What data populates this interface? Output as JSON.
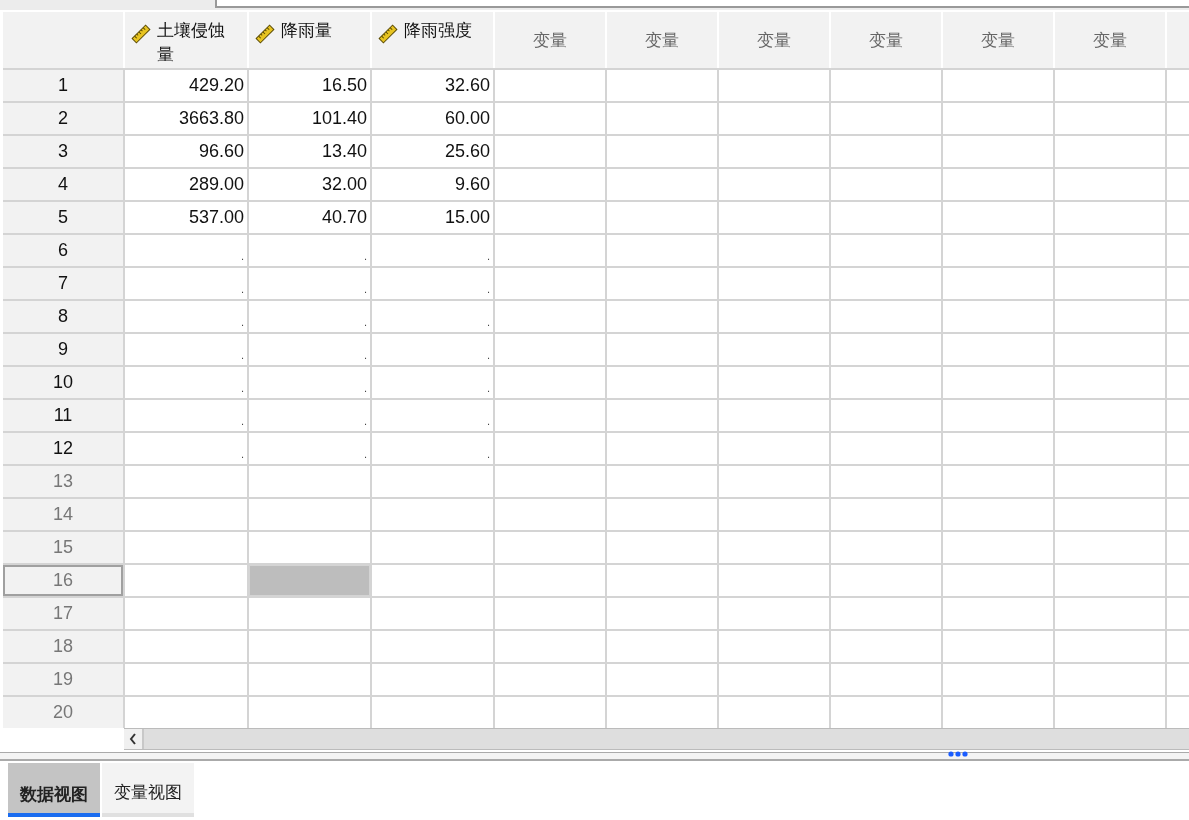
{
  "columns": [
    {
      "name": "土壤侵蚀量",
      "kind": "scale"
    },
    {
      "name": "降雨量",
      "kind": "scale"
    },
    {
      "name": "降雨强度",
      "kind": "scale"
    },
    {
      "name": "变量",
      "kind": "empty"
    },
    {
      "name": "变量",
      "kind": "empty"
    },
    {
      "name": "变量",
      "kind": "empty"
    },
    {
      "name": "变量",
      "kind": "empty"
    },
    {
      "name": "变量",
      "kind": "empty"
    },
    {
      "name": "变量",
      "kind": "empty"
    }
  ],
  "rows": [
    {
      "label": "1",
      "has_data": true,
      "selected": false,
      "cells": [
        {
          "value": "429.20",
          "selected": false
        },
        {
          "value": "16.50",
          "selected": false
        },
        {
          "value": "32.60",
          "selected": false
        }
      ]
    },
    {
      "label": "2",
      "has_data": true,
      "selected": false,
      "cells": [
        {
          "value": "3663.80",
          "selected": false
        },
        {
          "value": "101.40",
          "selected": false
        },
        {
          "value": "60.00",
          "selected": false
        }
      ]
    },
    {
      "label": "3",
      "has_data": true,
      "selected": false,
      "cells": [
        {
          "value": "96.60",
          "selected": false
        },
        {
          "value": "13.40",
          "selected": false
        },
        {
          "value": "25.60",
          "selected": false
        }
      ]
    },
    {
      "label": "4",
      "has_data": true,
      "selected": false,
      "cells": [
        {
          "value": "289.00",
          "selected": false
        },
        {
          "value": "32.00",
          "selected": false
        },
        {
          "value": "9.60",
          "selected": false
        }
      ]
    },
    {
      "label": "5",
      "has_data": true,
      "selected": false,
      "cells": [
        {
          "value": "537.00",
          "selected": false
        },
        {
          "value": "40.70",
          "selected": false
        },
        {
          "value": "15.00",
          "selected": false
        }
      ]
    },
    {
      "label": "6",
      "has_data": true,
      "selected": false,
      "cells": [
        {
          "value": ".",
          "selected": false
        },
        {
          "value": ".",
          "selected": false
        },
        {
          "value": ".",
          "selected": false
        }
      ]
    },
    {
      "label": "7",
      "has_data": true,
      "selected": false,
      "cells": [
        {
          "value": ".",
          "selected": false
        },
        {
          "value": ".",
          "selected": false
        },
        {
          "value": ".",
          "selected": false
        }
      ]
    },
    {
      "label": "8",
      "has_data": true,
      "selected": false,
      "cells": [
        {
          "value": ".",
          "selected": false
        },
        {
          "value": ".",
          "selected": false
        },
        {
          "value": ".",
          "selected": false
        }
      ]
    },
    {
      "label": "9",
      "has_data": true,
      "selected": false,
      "cells": [
        {
          "value": ".",
          "selected": false
        },
        {
          "value": ".",
          "selected": false
        },
        {
          "value": ".",
          "selected": false
        }
      ]
    },
    {
      "label": "10",
      "has_data": true,
      "selected": false,
      "cells": [
        {
          "value": ".",
          "selected": false
        },
        {
          "value": ".",
          "selected": false
        },
        {
          "value": ".",
          "selected": false
        }
      ]
    },
    {
      "label": "11",
      "has_data": true,
      "selected": false,
      "cells": [
        {
          "value": ".",
          "selected": false
        },
        {
          "value": ".",
          "selected": false
        },
        {
          "value": ".",
          "selected": false
        }
      ]
    },
    {
      "label": "12",
      "has_data": true,
      "selected": false,
      "cells": [
        {
          "value": ".",
          "selected": false
        },
        {
          "value": ".",
          "selected": false
        },
        {
          "value": ".",
          "selected": false
        }
      ]
    },
    {
      "label": "13",
      "has_data": false,
      "selected": false,
      "cells": [
        {
          "selected": false
        },
        {
          "selected": false
        },
        {
          "selected": false
        }
      ]
    },
    {
      "label": "14",
      "has_data": false,
      "selected": false,
      "cells": [
        {
          "selected": false
        },
        {
          "selected": false
        },
        {
          "selected": false
        }
      ]
    },
    {
      "label": "15",
      "has_data": false,
      "selected": false,
      "cells": [
        {
          "selected": false
        },
        {
          "selected": false
        },
        {
          "selected": false
        }
      ]
    },
    {
      "label": "16",
      "has_data": false,
      "selected": true,
      "cells": [
        {
          "selected": false
        },
        {
          "selected": true
        },
        {
          "selected": false
        }
      ]
    },
    {
      "label": "17",
      "has_data": false,
      "selected": false,
      "cells": [
        {
          "selected": false
        },
        {
          "selected": false
        },
        {
          "selected": false
        }
      ]
    },
    {
      "label": "18",
      "has_data": false,
      "selected": false,
      "cells": [
        {
          "selected": false
        },
        {
          "selected": false
        },
        {
          "selected": false
        }
      ]
    },
    {
      "label": "19",
      "has_data": false,
      "selected": false,
      "cells": [
        {
          "selected": false
        },
        {
          "selected": false
        },
        {
          "selected": false
        }
      ]
    },
    {
      "label": "20",
      "has_data": false,
      "selected": false,
      "cells": [
        {
          "selected": false
        },
        {
          "selected": false
        },
        {
          "selected": false
        }
      ]
    }
  ],
  "tabs": [
    {
      "label": "数据视图",
      "selected": true
    },
    {
      "label": "变量视图",
      "selected": false
    }
  ]
}
